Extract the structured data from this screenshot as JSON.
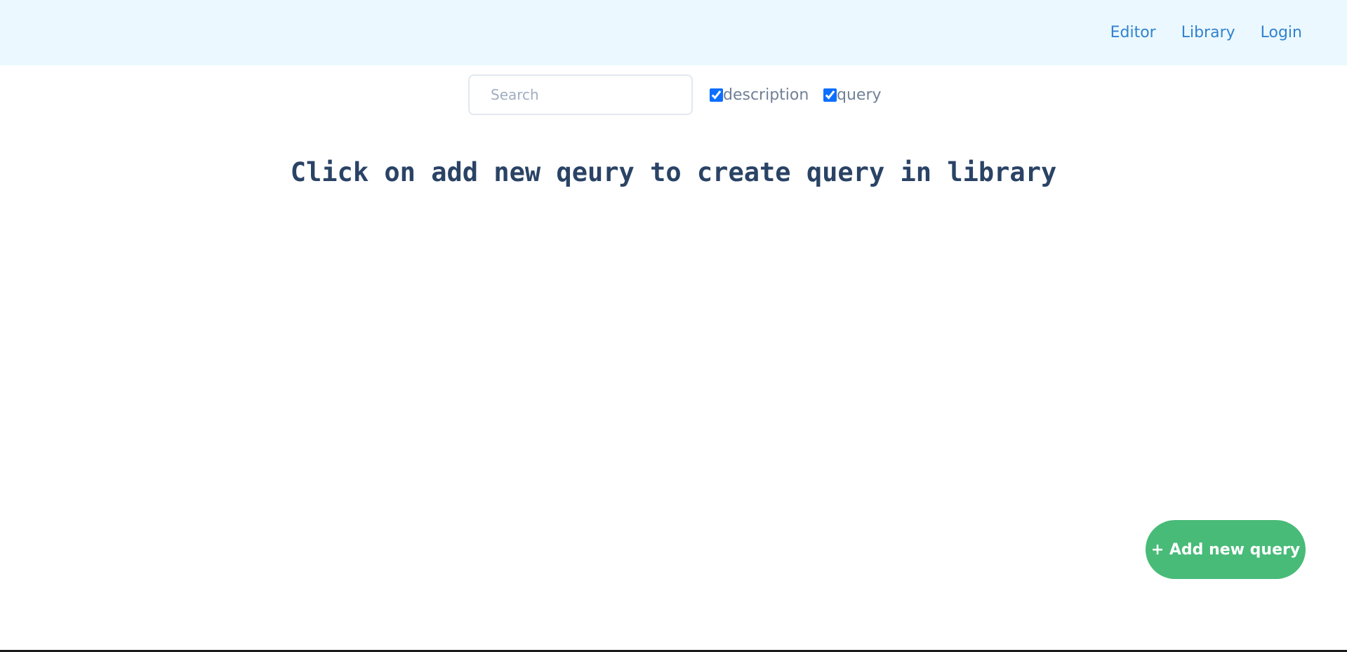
{
  "nav": {
    "links": [
      "Editor",
      "Library",
      "Login"
    ],
    "link_color": "#3182ce",
    "background": "#ebf8ff"
  },
  "search": {
    "placeholder": "Search",
    "value": ""
  },
  "filters": {
    "description": {
      "label": "description",
      "checked": true
    },
    "query": {
      "label": "query",
      "checked": true
    }
  },
  "main": {
    "empty_message": "Click on add new qeury to create query in library"
  },
  "actions": {
    "add_new_query_label": "+ Add new query",
    "add_button_color": "#48bb78"
  }
}
